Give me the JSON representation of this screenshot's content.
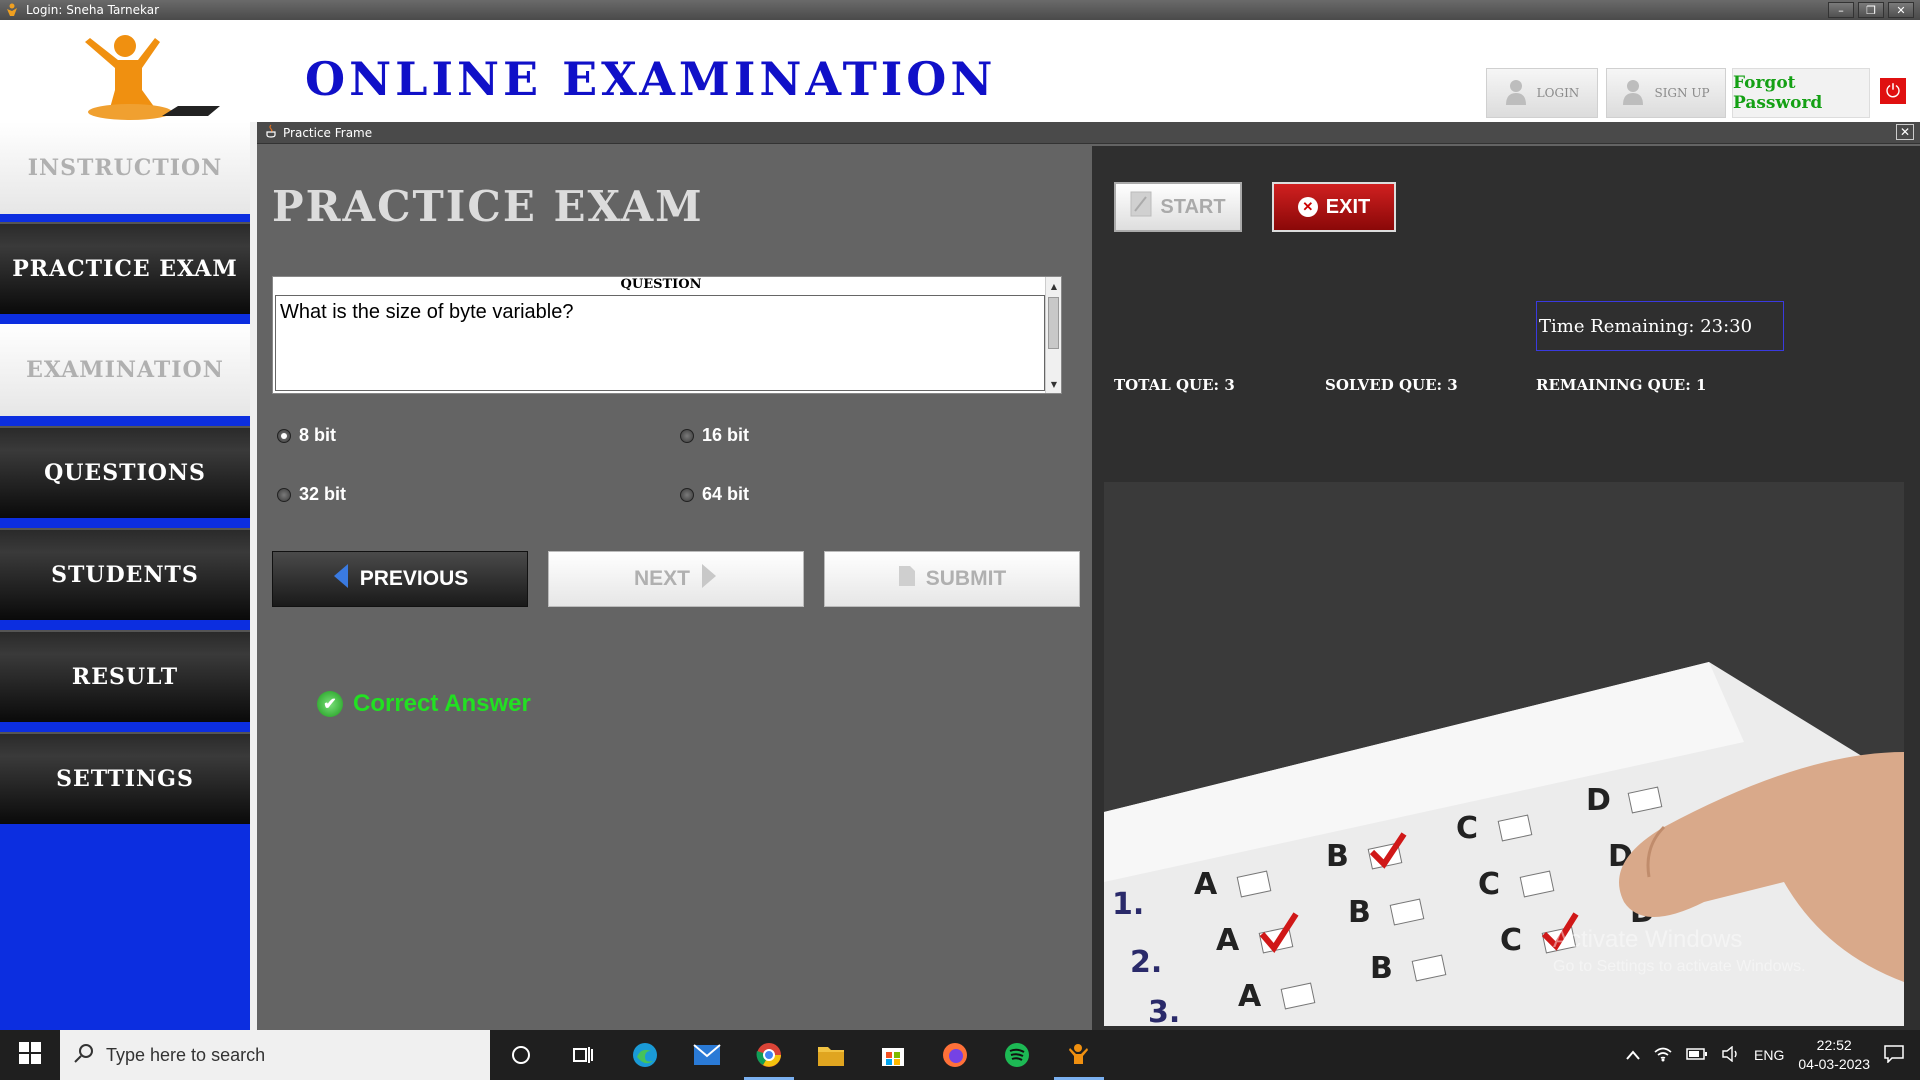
{
  "window": {
    "title": "Login: Sneha Tarnekar",
    "buttons": [
      "–",
      "❐",
      "✕"
    ]
  },
  "header": {
    "app_title": "ONLINE EXAMINATION",
    "login_label": "LOGIN",
    "signup_label": "SIGN UP",
    "forgot_label": "Forgot Password"
  },
  "sidebar": {
    "items": [
      {
        "label": "INSTRUCTION",
        "style": "light"
      },
      {
        "label": "PRACTICE EXAM",
        "style": "dark"
      },
      {
        "label": "EXAMINATION",
        "style": "light"
      },
      {
        "label": "QUESTIONS",
        "style": "dark"
      },
      {
        "label": "STUDENTS",
        "style": "dark"
      },
      {
        "label": "RESULT",
        "style": "dark"
      },
      {
        "label": "SETTINGS",
        "style": "dark"
      }
    ]
  },
  "practice_frame": {
    "title": "Practice Frame",
    "heading": "PRACTICE EXAM",
    "question_label": "QUESTION",
    "question_text": "What is the size of byte variable?",
    "options": [
      {
        "label": "8 bit",
        "selected": true
      },
      {
        "label": "16 bit",
        "selected": false
      },
      {
        "label": "32 bit",
        "selected": false
      },
      {
        "label": "64 bit",
        "selected": false
      }
    ],
    "prev_label": "PREVIOUS",
    "next_label": "NEXT",
    "submit_label": "SUBMIT",
    "result_text": "Correct Answer"
  },
  "right_panel": {
    "start_label": "START",
    "exit_label": "EXIT",
    "time_remaining": "Time Remaining: 23:30",
    "total_que": "TOTAL QUE: 3",
    "solved_que": "SOLVED QUE: 3",
    "remaining_que": "REMAINING QUE: 1",
    "sheet_rows": [
      {
        "num": "1.",
        "letters": [
          "A",
          "B",
          "C",
          "D"
        ],
        "checked": "B"
      },
      {
        "num": "2.",
        "letters": [
          "A",
          "B",
          "C",
          "D"
        ],
        "checked": "A"
      },
      {
        "num": "3.",
        "letters": [
          "A",
          "B",
          "C",
          "D"
        ],
        "checked": ""
      }
    ]
  },
  "watermark": {
    "line1": "Activate Windows",
    "line2": "Go to Settings to activate Windows."
  },
  "taskbar": {
    "search_placeholder": "Type here to search",
    "language": "ENG",
    "time": "22:52",
    "date": "04-03-2023"
  },
  "colors": {
    "brand_blue": "#1010c8",
    "sidebar_blue": "#0c2ee0",
    "correct_green": "#22e022",
    "exit_red": "#c01010"
  }
}
